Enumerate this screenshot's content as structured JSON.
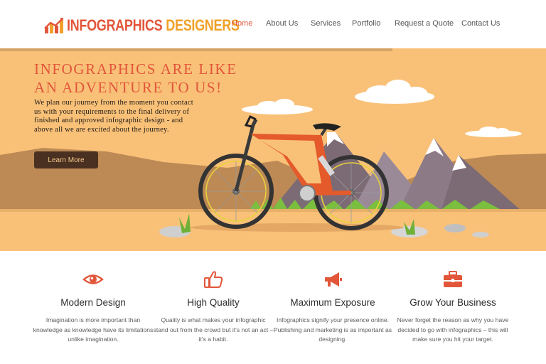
{
  "brand": {
    "name_part1": "INFOGRAPHICS",
    "name_part2": "DESIGNERS",
    "logo_icon": "bar-chart-logo-icon",
    "colors": {
      "red": "#e2563a",
      "orange": "#f0a12a"
    }
  },
  "nav": {
    "items": [
      {
        "label": "Home",
        "active": true
      },
      {
        "label": "About Us"
      },
      {
        "label": "Services"
      },
      {
        "label": "Portfolio"
      },
      {
        "label": "Request a Quote"
      },
      {
        "label": "Contact Us"
      }
    ]
  },
  "hero": {
    "title": "INFOGRAPHICS ARE LIKE\nAN ADVENTURE TO US!",
    "text": "We plan our journey from the moment you contact us with your requirements to the final delivery of finished and approved infographic design - and above all we are excited about the journey.",
    "button_label": "Learn More",
    "illustration": "mountain-bike-landscape",
    "colors": {
      "background": "#f9c178",
      "accent": "#e2563a",
      "button": "#4a3020"
    }
  },
  "features": [
    {
      "icon": "eye-icon",
      "title": "Modern Design",
      "text": "Imagination is more important than knowledge as knowledge have its limitations unlike imagination."
    },
    {
      "icon": "thumbs-up-icon",
      "title": "High Quality",
      "text": "Quality is what makes your infographic stand out from the crowd but it's not an act – it's a habit."
    },
    {
      "icon": "megaphone-icon",
      "title": "Maximum Exposure",
      "text": "Infographics signify your presence online. Publishing and marketing is as important as designing."
    },
    {
      "icon": "briefcase-icon",
      "title": "Grow Your Business",
      "text": "Never forget the reason as why you have decided to go with infographics – this will make sure you hit your target."
    }
  ]
}
